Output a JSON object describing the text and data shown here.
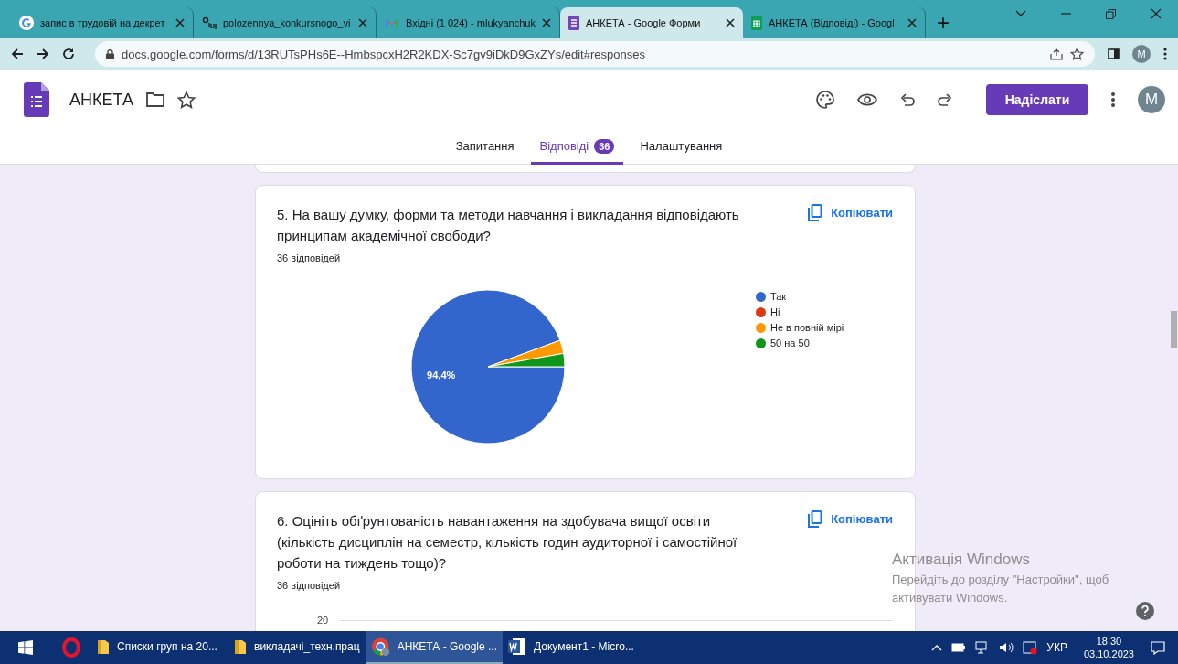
{
  "browser": {
    "tabs": [
      {
        "title": "запис в трудовій на декрет",
        "kind": "google",
        "selected": false
      },
      {
        "title": "polozennya_konkursnogo_vi",
        "kind": "doc",
        "selected": false
      },
      {
        "title": "Вхідні (1 024) - mlukyanchuk",
        "kind": "gmail",
        "selected": false
      },
      {
        "title": "АНКЕТА - Google Форми",
        "kind": "forms",
        "selected": true
      },
      {
        "title": "АНКЕТА (Відповіді) - Googl",
        "kind": "sheets",
        "selected": false
      }
    ],
    "new_tab": "+",
    "url": "docs.google.com/forms/d/13RUTsPHs6E--HmbspcxH2R2KDX-Sc7gv9iDkD9GxZYs/edit#responses",
    "profile": "M"
  },
  "form": {
    "title": "АНКЕТА",
    "send_button": "Надіслати",
    "avatar": "M",
    "tabs": [
      {
        "label": "Запитання",
        "selected": false
      },
      {
        "label": "Відповіді",
        "selected": true,
        "badge": "36"
      },
      {
        "label": "Налаштування",
        "selected": false
      }
    ]
  },
  "questions": [
    {
      "title": "5. На вашу думку, форми та методи навчання і викладання відповідають принципам академічної свободи?",
      "copy_button": "Копіювати",
      "responses": "36 відповідей",
      "chart_data": {
        "type": "pie",
        "categories": [
          "Так",
          "Ні",
          "Не в повній мірі",
          "50 на 50"
        ],
        "values": [
          94.4,
          0,
          2.8,
          2.8
        ],
        "colors": [
          "#3366cc",
          "#dc3912",
          "#ff9900",
          "#109618"
        ],
        "value_labels": [
          "94,4%",
          null,
          null,
          null
        ],
        "legend": "right"
      }
    },
    {
      "title": "6. Оцініть обґрунтованість навантаження на здобувача вищої освіти (кількість дисциплін на семестр, кількість годин аудиторної і самостійної роботи на тиждень тощо)?",
      "copy_button": "Копіювати",
      "responses": "36 відповідей",
      "chart_tick_label": "20"
    }
  ],
  "windows_notice": {
    "title": "Активація Windows",
    "text": "Перейдіть до розділу \"Настройки\", щоб активувати Windows."
  },
  "taskbar": {
    "items": [
      {
        "label": "Списки груп на  20...",
        "kind": "folder",
        "selected": false
      },
      {
        "label": "викладачі_техн.прац",
        "kind": "folder",
        "selected": false
      },
      {
        "label": "АНКЕТА - Google ...",
        "kind": "chrome",
        "selected": true
      },
      {
        "label": "Документ1 - Micro...",
        "kind": "word",
        "selected": false
      }
    ],
    "language": "УКР",
    "time": "18:30",
    "date": "03.10.2023"
  }
}
